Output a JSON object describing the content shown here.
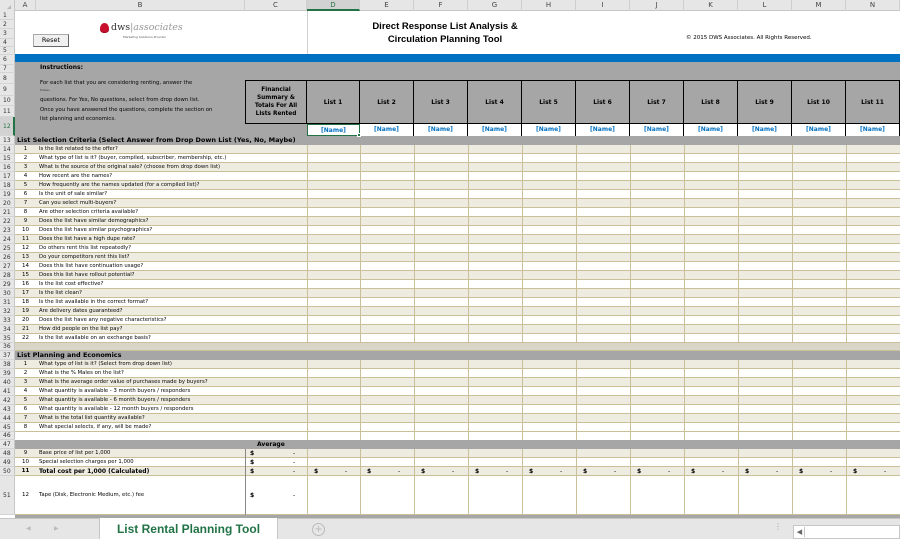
{
  "columns": [
    "A",
    "B",
    "C",
    "D",
    "E",
    "F",
    "G",
    "H",
    "I",
    "J",
    "K",
    "L",
    "M",
    "N"
  ],
  "selected_column": "D",
  "selected_row": "12",
  "header": {
    "reset_label": "Reset",
    "logo_text_main": "dws",
    "logo_text_sub": "associates",
    "logo_tagline": "Marketing Solutions Provider",
    "title_line1": "Direct Response List Analysis &",
    "title_line2": "Circulation Planning Tool",
    "copyright": "© 2015 DWS Associates.  All Rights Reserved."
  },
  "instructions": {
    "title": "Instructions:",
    "lines": [
      "For each list that you are considering renting, answer the",
      "questions. For Yes, No questions, select from drop down list.",
      "Once you have answered the questions, complete the section on",
      "list planning and economics."
    ],
    "stray_line": "follow..."
  },
  "financial_summary_label": [
    "Financial",
    "Summary &",
    "Totals For All",
    "Lists Rented"
  ],
  "lists": [
    {
      "label": "List 1",
      "name": "[Name]"
    },
    {
      "label": "List 2",
      "name": "[Name]"
    },
    {
      "label": "List 3",
      "name": "[Name]"
    },
    {
      "label": "List 4",
      "name": "[Name]"
    },
    {
      "label": "List 5",
      "name": "[Name]"
    },
    {
      "label": "List 6",
      "name": "[Name]"
    },
    {
      "label": "List 7",
      "name": "[Name]"
    },
    {
      "label": "List 8",
      "name": "[Name]"
    },
    {
      "label": "List 9",
      "name": "[Name]"
    },
    {
      "label": "List 10",
      "name": "[Name]"
    },
    {
      "label": "List 11",
      "name": "[Name]"
    }
  ],
  "section1": {
    "title": "List Selection Criteria (Select Answer from Drop Down List (Yes, No, Maybe)",
    "rows": [
      {
        "row": "14",
        "num": "1",
        "q": "Is the list related to the offer?"
      },
      {
        "row": "15",
        "num": "2",
        "q": "What type of list is it? (buyer, compiled, subscriber, membership, etc.)"
      },
      {
        "row": "16",
        "num": "3",
        "q": "What is the source of the original sale? (choose from drop down list)"
      },
      {
        "row": "17",
        "num": "4",
        "q": "How recent are the names?"
      },
      {
        "row": "18",
        "num": "5",
        "q": "How frequently are the names updated (for a compiled list)?"
      },
      {
        "row": "19",
        "num": "6",
        "q": "Is the unit of sale similar?"
      },
      {
        "row": "20",
        "num": "7",
        "q": "Can you select multi-buyers?"
      },
      {
        "row": "21",
        "num": "8",
        "q": "Are other selection criteria available?"
      },
      {
        "row": "22",
        "num": "9",
        "q": "Does the list have similar demographics?"
      },
      {
        "row": "23",
        "num": "10",
        "q": "Does the list have similar psychographics?"
      },
      {
        "row": "24",
        "num": "11",
        "q": "Does the list have a high dupe rate?"
      },
      {
        "row": "25",
        "num": "12",
        "q": "Do others rent this list repeatedly?"
      },
      {
        "row": "26",
        "num": "13",
        "q": "Do your competitors rent this list?"
      },
      {
        "row": "27",
        "num": "14",
        "q": "Does this list have continuation usage?"
      },
      {
        "row": "28",
        "num": "15",
        "q": "Does this list have rollout potential?"
      },
      {
        "row": "29",
        "num": "16",
        "q": "Is the list cost effective?"
      },
      {
        "row": "30",
        "num": "17",
        "q": "Is the list clean?"
      },
      {
        "row": "31",
        "num": "18",
        "q": "Is the list available in the correct format?"
      },
      {
        "row": "32",
        "num": "19",
        "q": "Are delivery dates guaranteed?"
      },
      {
        "row": "33",
        "num": "20",
        "q": "Does the list have any negative characteristics?"
      },
      {
        "row": "34",
        "num": "21",
        "q": "How did people on the list pay?"
      },
      {
        "row": "35",
        "num": "22",
        "q": "Is the list available on an exchange basis?"
      }
    ]
  },
  "section2": {
    "title": "List Planning and Economics",
    "rows": [
      {
        "row": "38",
        "num": "1",
        "q": "What type of list is it? (Select from drop down list)"
      },
      {
        "row": "39",
        "num": "2",
        "q": "What is the % Males on the list?"
      },
      {
        "row": "40",
        "num": "3",
        "q": "What is the average order value of purchases made by buyers?"
      },
      {
        "row": "41",
        "num": "4",
        "q": "What quantity is available - 3 month buyers / responders"
      },
      {
        "row": "42",
        "num": "5",
        "q": "What quantity is available - 6 month buyers / responders"
      },
      {
        "row": "43",
        "num": "6",
        "q": "What quantity is available - 12 month buyers / responders"
      },
      {
        "row": "44",
        "num": "7",
        "q": "What is the total list quantity available?"
      },
      {
        "row": "45",
        "num": "8",
        "q": "What special selects, if any, will be made?"
      }
    ]
  },
  "economics": {
    "average_label": "Average",
    "rows": [
      {
        "row": "48",
        "num": "9",
        "q": "Base price of list per 1,000",
        "avg_currency": "$",
        "avg_value": "-",
        "bold": false,
        "per_list": false
      },
      {
        "row": "49",
        "num": "10",
        "q": "Special selection charges per 1,000",
        "avg_currency": "$",
        "avg_value": "-",
        "bold": false,
        "per_list": false
      },
      {
        "row": "50",
        "num": "11",
        "q": "Total cost per 1,000 (Calculated)",
        "avg_currency": "$",
        "avg_value": "-",
        "bold": true,
        "per_list": true,
        "list_currency": "$",
        "list_value": "-"
      },
      {
        "row": "51",
        "num": "12",
        "q": "Tape (Disk, Electronic Medium, etc.) fee",
        "avg_currency": "$",
        "avg_value": "-",
        "bold": false,
        "per_list": false
      }
    ]
  },
  "blank_rows": [
    "1",
    "2",
    "3",
    "4",
    "5",
    "6",
    "7",
    "8",
    "9",
    "10",
    "11",
    "12",
    "13",
    "36",
    "37",
    "46",
    "47"
  ],
  "tabs": {
    "active": "List Rental Planning Tool",
    "add_sheet_icon": "plus-circle-icon",
    "nav_prev_icon": "triangle-left-icon",
    "nav_next_icon": "triangle-right-icon"
  },
  "colors": {
    "accent_blue": "#0070c0",
    "excel_green": "#217346",
    "header_gray": "#a6a6a6",
    "row_alt": "#eeece1",
    "grid_tan": "#c9c09a"
  }
}
